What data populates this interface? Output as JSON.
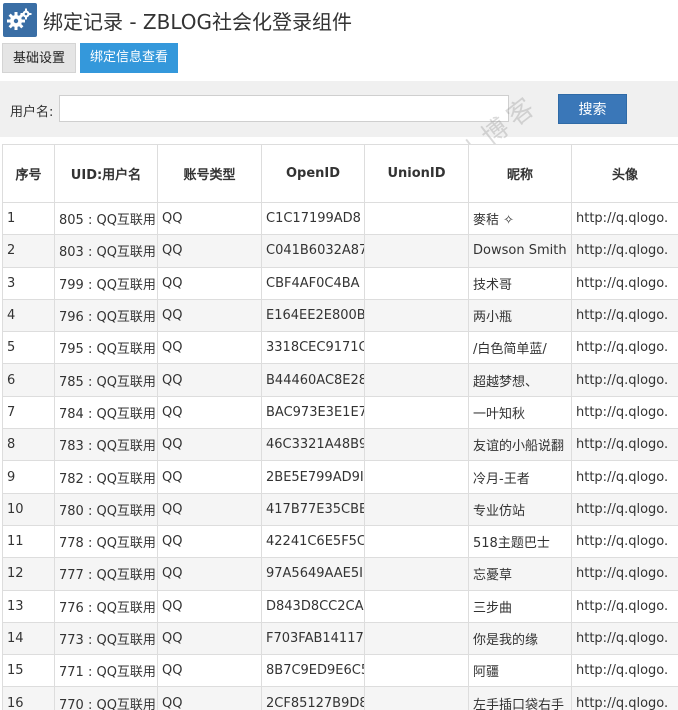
{
  "header": {
    "title": "绑定记录 - ZBLOG社会化登录组件",
    "icon": "gears-icon"
  },
  "tabs": [
    {
      "label": "基础设置",
      "active": false
    },
    {
      "label": "绑定信息查看",
      "active": true
    }
  ],
  "search": {
    "label": "用户名:",
    "value": "",
    "button_label": "搜索"
  },
  "watermark": "鸟儿博客",
  "table": {
    "columns": [
      "序号",
      "UID:用户名",
      "账号类型",
      "OpenID",
      "UnionID",
      "昵称",
      "头像"
    ],
    "rows": [
      [
        "1",
        "805 : QQ互联用",
        "QQ",
        "C1C17199AD8",
        "",
        "麥秸 ✧",
        "http://q.qlogo."
      ],
      [
        "2",
        "803 : QQ互联用",
        "QQ",
        "C041B6032A87",
        "",
        "Dowson Smith",
        "http://q.qlogo."
      ],
      [
        "3",
        "799 : QQ互联用",
        "QQ",
        "CBF4AF0C4BA",
        "",
        "技术哥",
        "http://q.qlogo."
      ],
      [
        "4",
        "796 : QQ互联用",
        "QQ",
        "E164EE2E800B",
        "",
        "两小瓶",
        "http://q.qlogo."
      ],
      [
        "5",
        "795 : QQ互联用",
        "QQ",
        "3318CEC9171C",
        "",
        "/白色简单蓝/",
        "http://q.qlogo."
      ],
      [
        "6",
        "785 : QQ互联用",
        "QQ",
        "B44460AC8E28",
        "",
        "超越梦想、",
        "http://q.qlogo."
      ],
      [
        "7",
        "784 : QQ互联用",
        "QQ",
        "BAC973E3E1E7",
        "",
        "一叶知秋",
        "http://q.qlogo."
      ],
      [
        "8",
        "783 : QQ互联用",
        "QQ",
        "46C3321A48B9",
        "",
        "友谊的小船说翻",
        "http://q.qlogo."
      ],
      [
        "9",
        "782 : QQ互联用",
        "QQ",
        "2BE5E799AD9I",
        "",
        "冷月-王者",
        "http://q.qlogo."
      ],
      [
        "10",
        "780 : QQ互联用",
        "QQ",
        "417B77E35CBE",
        "",
        "专业仿站",
        "http://q.qlogo."
      ],
      [
        "11",
        "778 : QQ互联用",
        "QQ",
        "42241C6E5F5C",
        "",
        "518主题巴士",
        "http://q.qlogo."
      ],
      [
        "12",
        "777 : QQ互联用",
        "QQ",
        "97A5649AAE5I",
        "",
        "忘憂草",
        "http://q.qlogo."
      ],
      [
        "13",
        "776 : QQ互联用",
        "QQ",
        "D843D8CC2CA",
        "",
        "三步曲",
        "http://q.qlogo."
      ],
      [
        "14",
        "773 : QQ互联用",
        "QQ",
        "F703FAB14117",
        "",
        "你是我的缘",
        "http://q.qlogo."
      ],
      [
        "15",
        "771 : QQ互联用",
        "QQ",
        "8B7C9ED9E6C5",
        "",
        "阿疆",
        "http://q.qlogo."
      ],
      [
        "16",
        "770 : QQ互联用",
        "QQ",
        "2CF85127B9D8",
        "",
        "左手插口袋右手",
        "http://q.qlogo."
      ]
    ]
  }
}
